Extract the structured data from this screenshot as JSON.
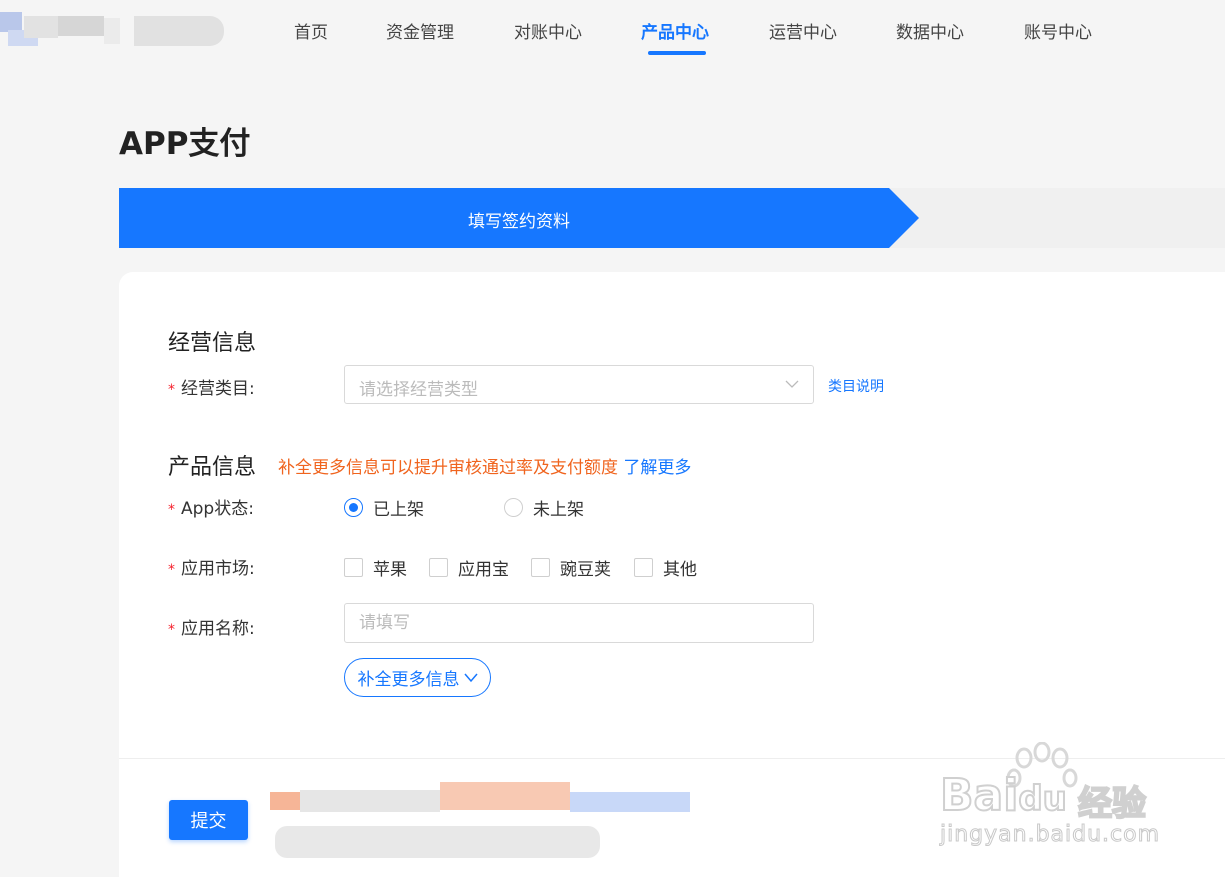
{
  "nav": {
    "items": [
      {
        "label": "首页",
        "active": false
      },
      {
        "label": "资金管理",
        "active": false
      },
      {
        "label": "对账中心",
        "active": false
      },
      {
        "label": "产品中心",
        "active": true
      },
      {
        "label": "运营中心",
        "active": false
      },
      {
        "label": "数据中心",
        "active": false
      },
      {
        "label": "账号中心",
        "active": false
      }
    ]
  },
  "page": {
    "title": "APP支付"
  },
  "steps": {
    "active_label": "填写签约资料"
  },
  "business": {
    "section_title": "经营信息",
    "category_label": "经营类目:",
    "category_placeholder": "请选择经营类型",
    "category_help": "类目说明"
  },
  "product": {
    "section_title": "产品信息",
    "hint": "补全更多信息可以提升审核通过率及支付额度",
    "hint_link": "了解更多",
    "status_label": "App状态:",
    "status_options": [
      {
        "label": "已上架",
        "selected": true
      },
      {
        "label": "未上架",
        "selected": false
      }
    ],
    "market_label": "应用市场:",
    "market_options": [
      {
        "label": "苹果",
        "checked": false
      },
      {
        "label": "应用宝",
        "checked": false
      },
      {
        "label": "豌豆荚",
        "checked": false
      },
      {
        "label": "其他",
        "checked": false
      }
    ],
    "name_label": "应用名称:",
    "name_placeholder": "请填写",
    "more_button": "补全更多信息"
  },
  "footer": {
    "submit_label": "提交"
  },
  "watermark": {
    "brand": "Bai",
    "brand_du": "du",
    "brand_cn": "经验",
    "url": "jingyan.baidu.com"
  },
  "colors": {
    "primary": "#1677ff",
    "required": "#f5222d",
    "hint": "#f0641e"
  }
}
